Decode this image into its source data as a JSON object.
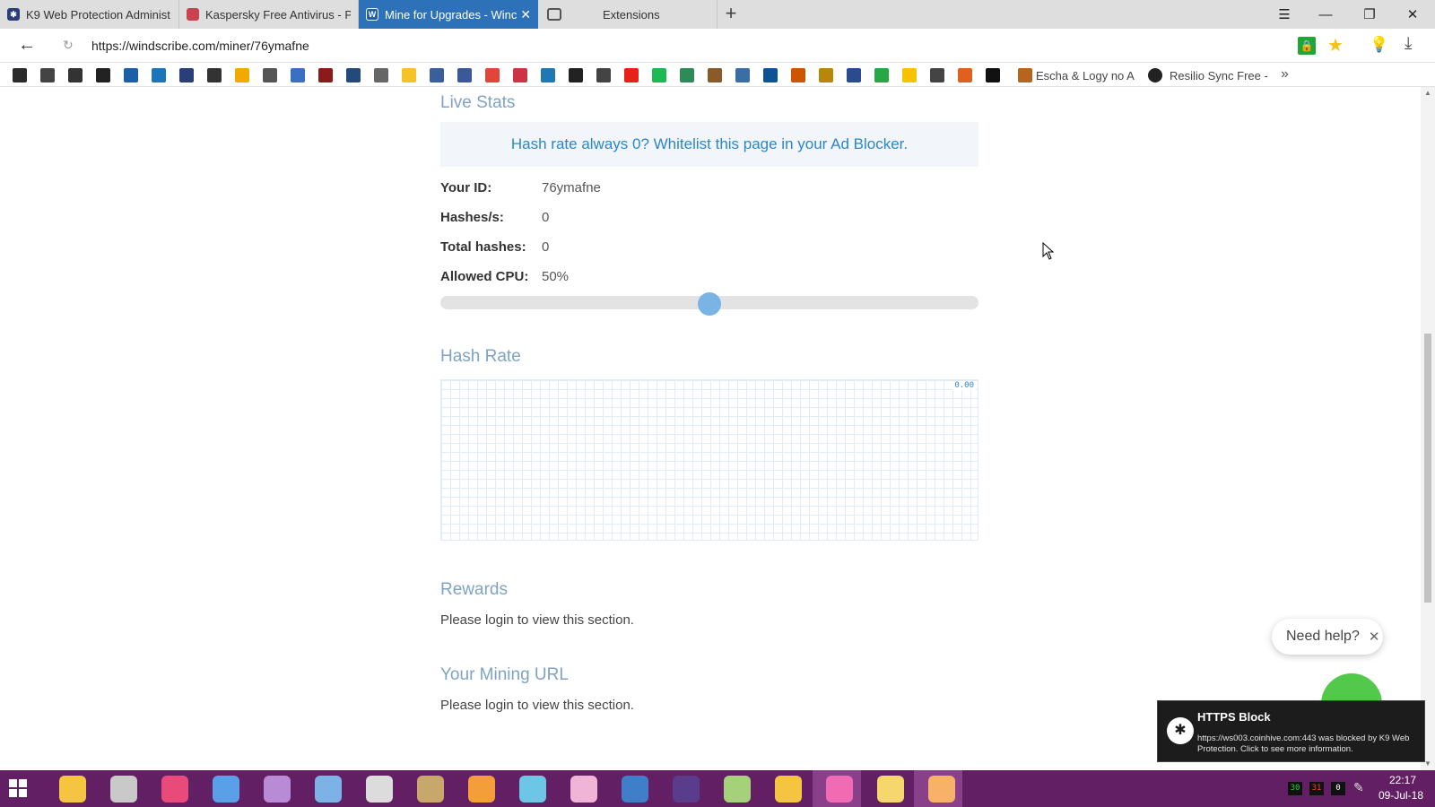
{
  "browser": {
    "tabs": [
      {
        "label": "K9 Web Protection Administ",
        "active": false,
        "favicon_color": "#2a3f7a"
      },
      {
        "label": "Kaspersky Free Antivirus - Pr",
        "active": false,
        "favicon_color": "#c9424c"
      },
      {
        "label": "Mine for Upgrades - Winc",
        "active": true,
        "favicon_color": "#1f5fa7",
        "favicon_text": "W"
      },
      {
        "label": "Extensions",
        "active": false,
        "favicon_color": "#555555"
      }
    ],
    "url": "https://windscribe.com/miner/76ymafne",
    "window_controls": {
      "menu": "☰",
      "minimize": "—",
      "restore": "❐",
      "close": "✕"
    },
    "bookmarks": {
      "icon_colors": [
        "#2b2b2b",
        "#444444",
        "#333333",
        "#222222",
        "#1a5fa8",
        "#1b75bb",
        "#2a3f7a",
        "#333333",
        "#f2a900",
        "#555555",
        "#3a6fc2",
        "#8b1a1a",
        "#24497b",
        "#666666",
        "#f5c227",
        "#3a5f9c",
        "#3b5998",
        "#e3453a",
        "#cc3344",
        "#1f77b4",
        "#222222",
        "#444444",
        "#e62117",
        "#1db954",
        "#2e8b57",
        "#8b5a2b",
        "#3a6ea5",
        "#0b5394",
        "#cc5500",
        "#b8860b",
        "#2a4b8d",
        "#28a745",
        "#f7c300",
        "#444444",
        "#e06020",
        "#111111",
        "#b5651d"
      ],
      "labels": [
        "Escha & Logy no A",
        "Resilio Sync Free -"
      ],
      "overflow": "»"
    }
  },
  "page": {
    "live_stats_title": "Live Stats",
    "whitelist_notice": "Hash rate always 0? Whitelist this page in your Ad Blocker.",
    "stats": [
      {
        "label": "Your ID:",
        "value": "76ymafne"
      },
      {
        "label": "Hashes/s:",
        "value": "0"
      },
      {
        "label": "Total hashes:",
        "value": "0"
      },
      {
        "label": "Allowed CPU:",
        "value": "50%"
      }
    ],
    "cpu_slider_fraction": 0.5,
    "hash_rate_title": "Hash Rate",
    "hash_rate_value": "0.00",
    "rewards_title": "Rewards",
    "rewards_text": "Please login to view this section.",
    "mining_url_title": "Your Mining URL",
    "mining_url_text": "Please login to view this section.",
    "help_label": "Need help?"
  },
  "notification": {
    "title": "HTTPS Block",
    "body": "https://ws003.coinhive.com:443 was blocked by K9 Web Protection. Click to see more information."
  },
  "taskbar": {
    "icon_colors": [
      "#f5c542",
      "#c9c9c9",
      "#e84b7a",
      "#5aa0e8",
      "#b98ad6",
      "#7cb2e6",
      "#dcdcdc",
      "#c7a86a",
      "#f49e3a",
      "#6ec6e6",
      "#f0b4d6",
      "#3f7fc9",
      "#5a3c8c",
      "#a5d17a",
      "#f5c542",
      "#f06ab4",
      "#f5d76e",
      "#f7b267"
    ],
    "tray": [
      "30",
      "31",
      "0"
    ],
    "time": "22:17",
    "date": "09-Jul-18"
  },
  "colors": {
    "accent": "#2d72b9",
    "section_title": "#7fa3c2",
    "link": "#2b87c8",
    "taskbar": "#631f63"
  }
}
